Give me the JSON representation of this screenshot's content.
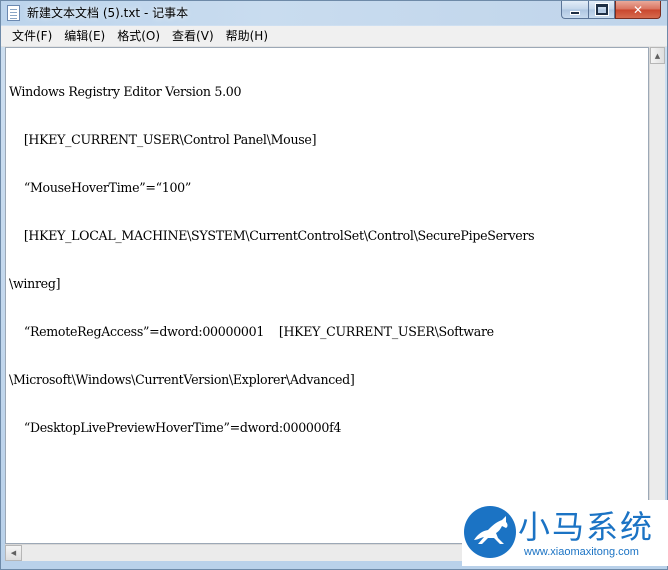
{
  "window": {
    "title": "新建文本文档 (5).txt - 记事本",
    "icon": "notepad-icon",
    "close_label": "✕"
  },
  "menu": [
    {
      "label": "文件(F)"
    },
    {
      "label": "编辑(E)"
    },
    {
      "label": "格式(O)"
    },
    {
      "label": "查看(V)"
    },
    {
      "label": "帮助(H)"
    }
  ],
  "editor": {
    "lines": [
      "Windows Registry Editor Version 5.00",
      "    [HKEY_CURRENT_USER\\Control Panel\\Mouse]",
      "    “MouseHoverTime”=“100”",
      "    [HKEY_LOCAL_MACHINE\\SYSTEM\\CurrentControlSet\\Control\\SecurePipeServers",
      "\\winreg]",
      "    “RemoteRegAccess”=dword:00000001    [HKEY_CURRENT_USER\\Software",
      "\\Microsoft\\Windows\\CurrentVersion\\Explorer\\Advanced]",
      "    “DesktopLivePreviewHoverTime”=dword:000000f4"
    ]
  },
  "watermark": {
    "name": "小马系统",
    "url": "www.xiaomaxitong.com",
    "logo": "horse-logo-icon"
  },
  "colors": {
    "watermark_blue": "#1b73c4",
    "close_red": "#c9452c"
  }
}
